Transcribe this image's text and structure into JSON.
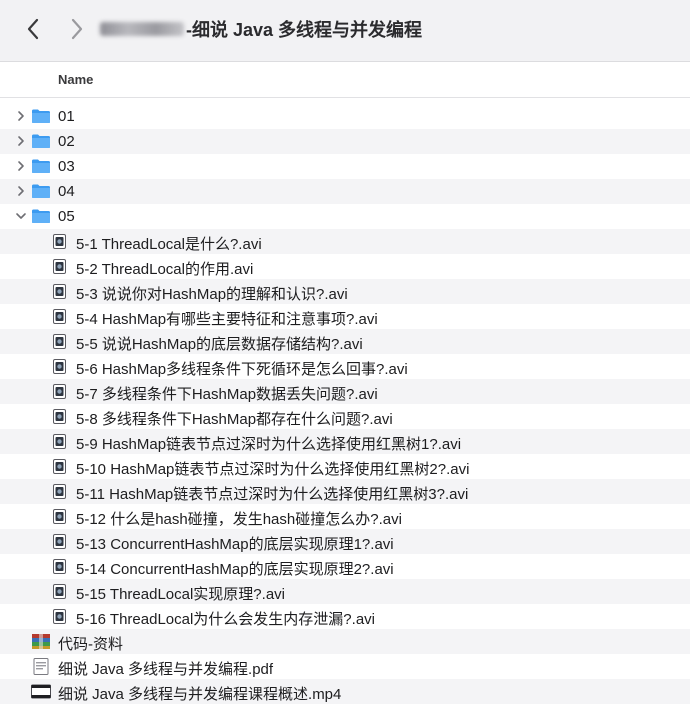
{
  "window": {
    "title": "-细说 Java 多线程与并发编程"
  },
  "columns": {
    "name": "Name"
  },
  "folders_before": [
    {
      "label": "01",
      "expanded": false
    },
    {
      "label": "02",
      "expanded": false
    },
    {
      "label": "03",
      "expanded": false
    },
    {
      "label": "04",
      "expanded": false
    }
  ],
  "open_folder": {
    "label": "05",
    "expanded": true
  },
  "files": [
    "5-1 ThreadLocal是什么?.avi",
    "5-2 ThreadLocal的作用.avi",
    "5-3 说说你对HashMap的理解和认识?.avi",
    "5-4 HashMap有哪些主要特征和注意事项?.avi",
    "5-5 说说HashMap的底层数据存储结构?.avi",
    "5-6 HashMap多线程条件下死循环是怎么回事?.avi",
    "5-7 多线程条件下HashMap数据丢失问题?.avi",
    "5-8 多线程条件下HashMap都存在什么问题?.avi",
    "5-9 HashMap链表节点过深时为什么选择使用红黑树1?.avi",
    "5-10 HashMap链表节点过深时为什么选择使用红黑树2?.avi",
    "5-11 HashMap链表节点过深时为什么选择使用红黑树3?.avi",
    "5-12 什么是hash碰撞，发生hash碰撞怎么办?.avi",
    "5-13 ConcurrentHashMap的底层实现原理1?.avi",
    "5-14 ConcurrentHashMap的底层实现原理2?.avi",
    "5-15 ThreadLocal实现原理?.avi",
    "5-16 ThreadLocal为什么会发生内存泄漏?.avi"
  ],
  "root_items": [
    {
      "label": "代码-资料",
      "icon": "archive-icon"
    },
    {
      "label": "细说 Java 多线程与并发编程.pdf",
      "icon": "pdf-icon"
    },
    {
      "label": "细说 Java 多线程与并发编程课程概述.mp4",
      "icon": "video-icon"
    }
  ],
  "colors": {
    "folder_blue": "#3d9bf0",
    "stripe": "#f4f4f6",
    "toolbar": "#f2f2f4"
  }
}
